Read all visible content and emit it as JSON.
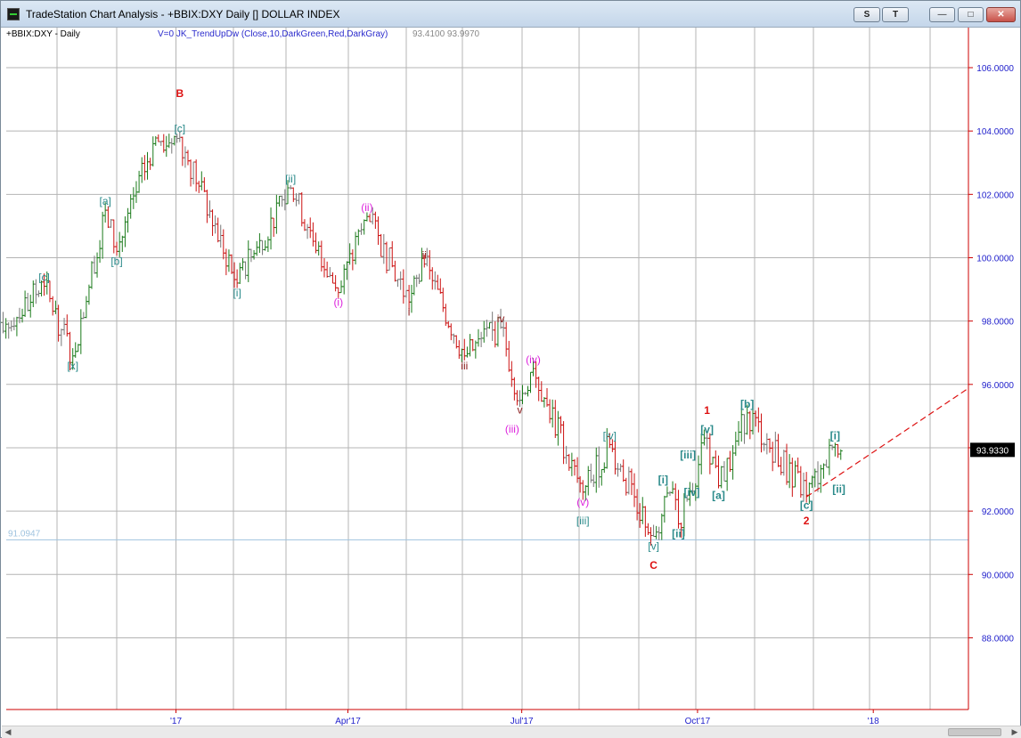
{
  "window": {
    "title": "TradeStation Chart Analysis - +BBIX:DXY Daily [] DOLLAR INDEX",
    "buttons": {
      "s": "S",
      "t": "T",
      "minimize": "—",
      "maximize": "□",
      "close": "✕"
    }
  },
  "header": {
    "symbol": "+BBIX:DXY - Daily",
    "indicator": "V=0  JK_TrendUpDw  (Close,10,DarkGreen,Red,DarkGray)",
    "readout": "93.4100  93.9970"
  },
  "colors": {
    "up": "#1a7a1a",
    "down": "#cc1111",
    "neutral": "#777777",
    "axis": "#cc0000",
    "tick": "#2222cc",
    "teal": "#2a8a8a",
    "magenta": "#dd22dd",
    "darkred": "#8b1a1a",
    "red": "#dd1111",
    "ref": "#9fc3df"
  },
  "chart_data": {
    "type": "ohlc",
    "ylim": [
      86.0,
      107.5
    ],
    "y_ticks": [
      "106.0000",
      "104.0000",
      "102.0000",
      "100.0000",
      "98.0000",
      "96.0000",
      "94.0000",
      "92.0000",
      "90.0000",
      "88.0000"
    ],
    "y_tick_values": [
      106,
      104,
      102,
      100,
      98,
      96,
      94,
      92,
      90,
      88
    ],
    "x_ticks": [
      "'17",
      "Apr'17",
      "Jul'17",
      "Oct'17",
      "'18"
    ],
    "x_tick_dates": [
      "2017-01-01",
      "2017-04-01",
      "2017-07-01",
      "2017-10-01",
      "2018-01-01"
    ],
    "last_price": "93.9330",
    "last_value": 93.933,
    "ref_level": "91.0947",
    "ref_value": 91.0947,
    "swing_points": [
      [
        "2016-09-19",
        96.2
      ],
      [
        "2016-10-04",
        97.9
      ],
      [
        "2016-10-24",
        99.1
      ],
      [
        "2016-11-08",
        96.9
      ],
      [
        "2016-11-25",
        101.5
      ],
      [
        "2016-12-01",
        100.2
      ],
      [
        "2016-12-20",
        103.6
      ],
      [
        "2017-01-03",
        103.8
      ],
      [
        "2017-02-02",
        99.2
      ],
      [
        "2017-03-02",
        102.2
      ],
      [
        "2017-03-27",
        98.9
      ],
      [
        "2017-04-11",
        101.3
      ],
      [
        "2017-05-03",
        98.6
      ],
      [
        "2017-05-11",
        99.8
      ],
      [
        "2017-06-01",
        96.9
      ],
      [
        "2017-06-20",
        97.8
      ],
      [
        "2017-06-30",
        95.5
      ],
      [
        "2017-07-07",
        96.5
      ],
      [
        "2017-08-02",
        92.6
      ],
      [
        "2017-08-16",
        94.1
      ],
      [
        "2017-09-08",
        91.2
      ],
      [
        "2017-09-18",
        92.7
      ],
      [
        "2017-09-21",
        91.6
      ],
      [
        "2017-10-06",
        94.3
      ],
      [
        "2017-10-12",
        92.8
      ],
      [
        "2017-10-27",
        95.1
      ],
      [
        "2017-11-27",
        92.5
      ],
      [
        "2017-12-12",
        94.1
      ],
      [
        "2017-12-15",
        93.9
      ]
    ],
    "wave_labels": [
      {
        "text": "[c]",
        "date": "2016-10-24",
        "price": 99.1,
        "pos": "above",
        "color": "teal"
      },
      {
        "text": "[x]",
        "date": "2016-11-08",
        "price": 96.9,
        "pos": "below",
        "color": "teal"
      },
      {
        "text": "[a]",
        "date": "2016-11-25",
        "price": 101.5,
        "pos": "above",
        "color": "teal"
      },
      {
        "text": "[b]",
        "date": "2016-12-01",
        "price": 100.2,
        "pos": "below",
        "color": "teal"
      },
      {
        "text": "[c]",
        "date": "2017-01-03",
        "price": 103.8,
        "pos": "above",
        "color": "teal"
      },
      {
        "text": "B",
        "date": "2017-01-03",
        "price": 104.9,
        "pos": "above",
        "color": "red",
        "bold": true
      },
      {
        "text": "[i]",
        "date": "2017-02-02",
        "price": 99.2,
        "pos": "below",
        "color": "teal"
      },
      {
        "text": "[ii]",
        "date": "2017-03-02",
        "price": 102.2,
        "pos": "above",
        "color": "teal"
      },
      {
        "text": "(i)",
        "date": "2017-03-27",
        "price": 98.9,
        "pos": "below",
        "color": "magenta"
      },
      {
        "text": "(ii)",
        "date": "2017-04-11",
        "price": 101.3,
        "pos": "above",
        "color": "magenta"
      },
      {
        "text": "i",
        "date": "2017-05-03",
        "price": 98.6,
        "pos": "below",
        "color": "darkred"
      },
      {
        "text": "ii",
        "date": "2017-05-11",
        "price": 99.8,
        "pos": "above",
        "color": "darkred"
      },
      {
        "text": "iii",
        "date": "2017-06-01",
        "price": 96.9,
        "pos": "below",
        "color": "darkred"
      },
      {
        "text": "iv",
        "date": "2017-06-20",
        "price": 97.8,
        "pos": "above",
        "color": "darkred"
      },
      {
        "text": "v",
        "date": "2017-06-30",
        "price": 95.5,
        "pos": "below",
        "color": "darkred"
      },
      {
        "text": "(iii)",
        "date": "2017-06-26",
        "price": 94.9,
        "pos": "below",
        "color": "magenta"
      },
      {
        "text": "(iv)",
        "date": "2017-07-07",
        "price": 96.5,
        "pos": "above",
        "color": "magenta"
      },
      {
        "text": "(v)",
        "date": "2017-08-02",
        "price": 92.6,
        "pos": "below",
        "color": "magenta"
      },
      {
        "text": "[iii]",
        "date": "2017-08-02",
        "price": 92.0,
        "pos": "below",
        "color": "teal"
      },
      {
        "text": "[iv]",
        "date": "2017-08-16",
        "price": 94.1,
        "pos": "above",
        "color": "teal"
      },
      {
        "text": "[v]",
        "date": "2017-09-08",
        "price": 91.2,
        "pos": "below",
        "color": "teal"
      },
      {
        "text": "C",
        "date": "2017-09-08",
        "price": 90.6,
        "pos": "below",
        "color": "red",
        "bold": true
      },
      {
        "text": "[i]",
        "date": "2017-09-13",
        "price": 92.7,
        "pos": "above",
        "color": "teal",
        "bold": true
      },
      {
        "text": "[ii]",
        "date": "2017-09-21",
        "price": 91.6,
        "pos": "below",
        "color": "teal",
        "bold": true
      },
      {
        "text": "[iii]",
        "date": "2017-09-26",
        "price": 93.5,
        "pos": "above",
        "color": "teal",
        "bold": true
      },
      {
        "text": "[iv]",
        "date": "2017-09-28",
        "price": 92.9,
        "pos": "below",
        "color": "teal",
        "bold": true
      },
      {
        "text": "[v]",
        "date": "2017-10-06",
        "price": 94.3,
        "pos": "above",
        "color": "teal",
        "bold": true
      },
      {
        "text": "1",
        "date": "2017-10-06",
        "price": 94.9,
        "pos": "above",
        "color": "red",
        "bold": true
      },
      {
        "text": "[a]",
        "date": "2017-10-12",
        "price": 92.8,
        "pos": "below",
        "color": "teal",
        "bold": true
      },
      {
        "text": "[b]",
        "date": "2017-10-27",
        "price": 95.1,
        "pos": "above",
        "color": "teal",
        "bold": true
      },
      {
        "text": "[c]",
        "date": "2017-11-27",
        "price": 92.5,
        "pos": "below",
        "color": "teal",
        "bold": true
      },
      {
        "text": "2",
        "date": "2017-11-27",
        "price": 92.0,
        "pos": "below",
        "color": "red",
        "bold": true
      },
      {
        "text": "[i]",
        "date": "2017-12-12",
        "price": 94.1,
        "pos": "above",
        "color": "teal",
        "bold": true
      },
      {
        "text": "[ii]",
        "date": "2017-12-14",
        "price": 93.0,
        "pos": "below",
        "color": "teal",
        "bold": true
      }
    ],
    "trendline": {
      "start": [
        "2017-11-27",
        92.45
      ],
      "end": [
        "2018-03-01",
        96.25
      ]
    }
  }
}
